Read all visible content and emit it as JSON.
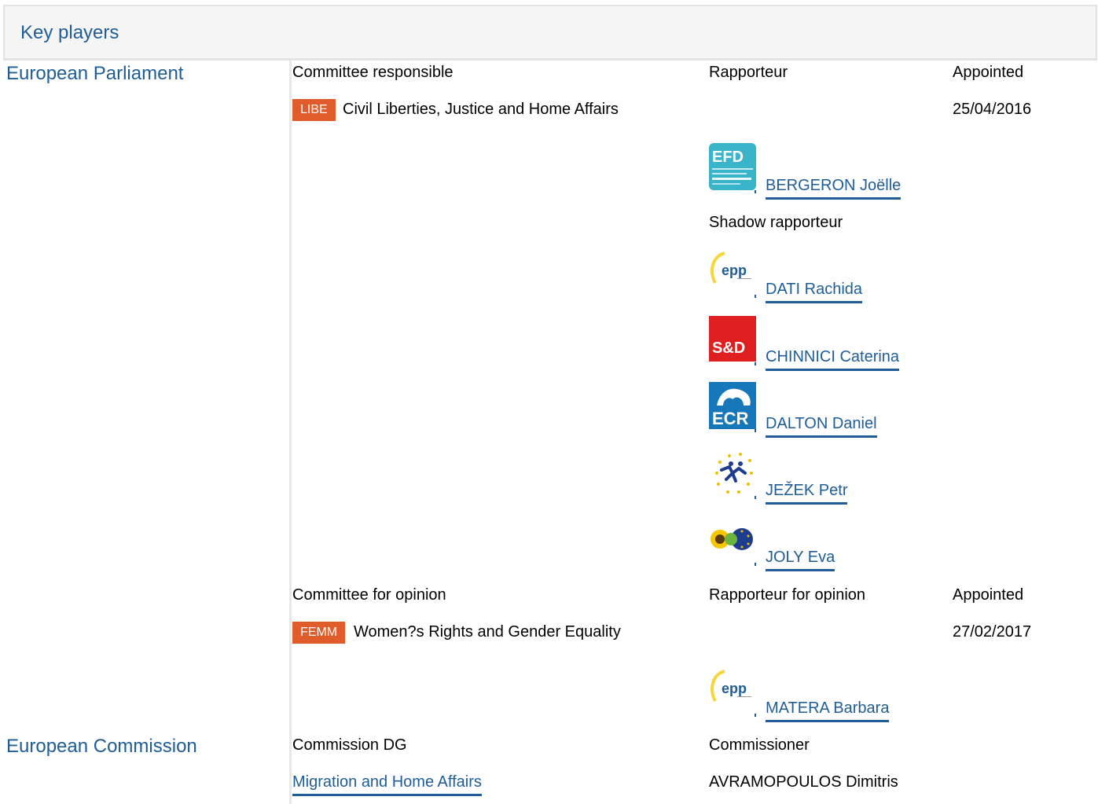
{
  "header": {
    "title": "Key players"
  },
  "parliament": {
    "label": "European Parliament",
    "committee_responsible": {
      "col_committee": "Committee responsible",
      "col_rapporteur": "Rapporteur",
      "col_appointed": "Appointed",
      "badge": "LIBE",
      "name": "Civil Liberties, Justice and Home Affairs",
      "appointed": "25/04/2016",
      "rapporteur": {
        "name": "BERGERON Joëlle",
        "group_logo": "efdd-logo"
      },
      "shadow_label": "Shadow rapporteur",
      "shadows": [
        {
          "name": "DATI Rachida",
          "group_logo": "epp-logo"
        },
        {
          "name": "CHINNICI Caterina",
          "group_logo": "sd-logo"
        },
        {
          "name": "DALTON Daniel",
          "group_logo": "ecr-logo"
        },
        {
          "name": "JEŽEK Petr",
          "group_logo": "alde-logo"
        },
        {
          "name": "JOLY Eva",
          "group_logo": "greens-efa-logo"
        }
      ]
    },
    "committee_opinion": {
      "col_committee": "Committee for opinion",
      "col_rapporteur": "Rapporteur for opinion",
      "col_appointed": "Appointed",
      "badge": "FEMM",
      "name": "Women?s Rights and Gender Equality",
      "appointed": "27/02/2017",
      "rapporteur": {
        "name": "MATERA Barbara",
        "group_logo": "epp-logo"
      }
    }
  },
  "commission": {
    "label": "European Commission",
    "col_dg": "Commission DG",
    "col_commissioner": "Commissioner",
    "dg": "Migration and Home Affairs",
    "commissioner": "AVRAMOPOULOS Dimitris"
  },
  "logo_text": {
    "efdd": "EFD",
    "epp": "epp",
    "sd": "S&D",
    "ecr": "ECR"
  },
  "colors": {
    "link": "#1f5d97",
    "badge": "#e05c2b",
    "efdd": "#3ab4c8",
    "sd": "#e02020",
    "ecr": "#1678b8"
  }
}
